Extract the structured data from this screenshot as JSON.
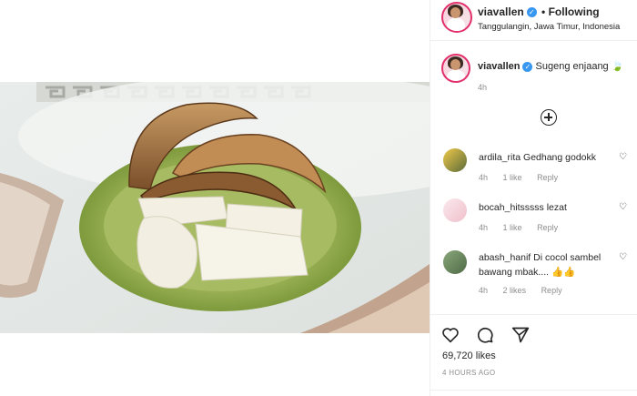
{
  "post": {
    "username": "viavallen",
    "follow_status": "• Following",
    "location": "Tanggulangin, Jawa Timur, Indonesia",
    "caption_user": "viavallen",
    "caption_text": "Sugeng enjaang 🍃",
    "caption_time": "4h",
    "likes": "69,720 likes",
    "time_ago": "4 HOURS AGO"
  },
  "comments": [
    {
      "user": "ardila_rita",
      "text": "Gedhang godokk",
      "time": "4h",
      "likes": "1 like",
      "reply": "Reply"
    },
    {
      "user": "bocah_hitsssss",
      "text": "lezat",
      "time": "4h",
      "likes": "1 like",
      "reply": "Reply"
    },
    {
      "user": "abash_hanif",
      "text": "Di cocol sambel bawang mbak.... 👍👍",
      "time": "4h",
      "likes": "2 likes",
      "reply": "Reply"
    }
  ],
  "icons": {
    "like": "heart-icon",
    "comment": "comment-icon",
    "share": "share-icon",
    "verified": "verified-badge-icon",
    "load_more": "plus-circle-icon"
  },
  "colors": {
    "verified": "#3897f0",
    "story_ring": "#e1306c",
    "muted": "#8e8e8e"
  }
}
